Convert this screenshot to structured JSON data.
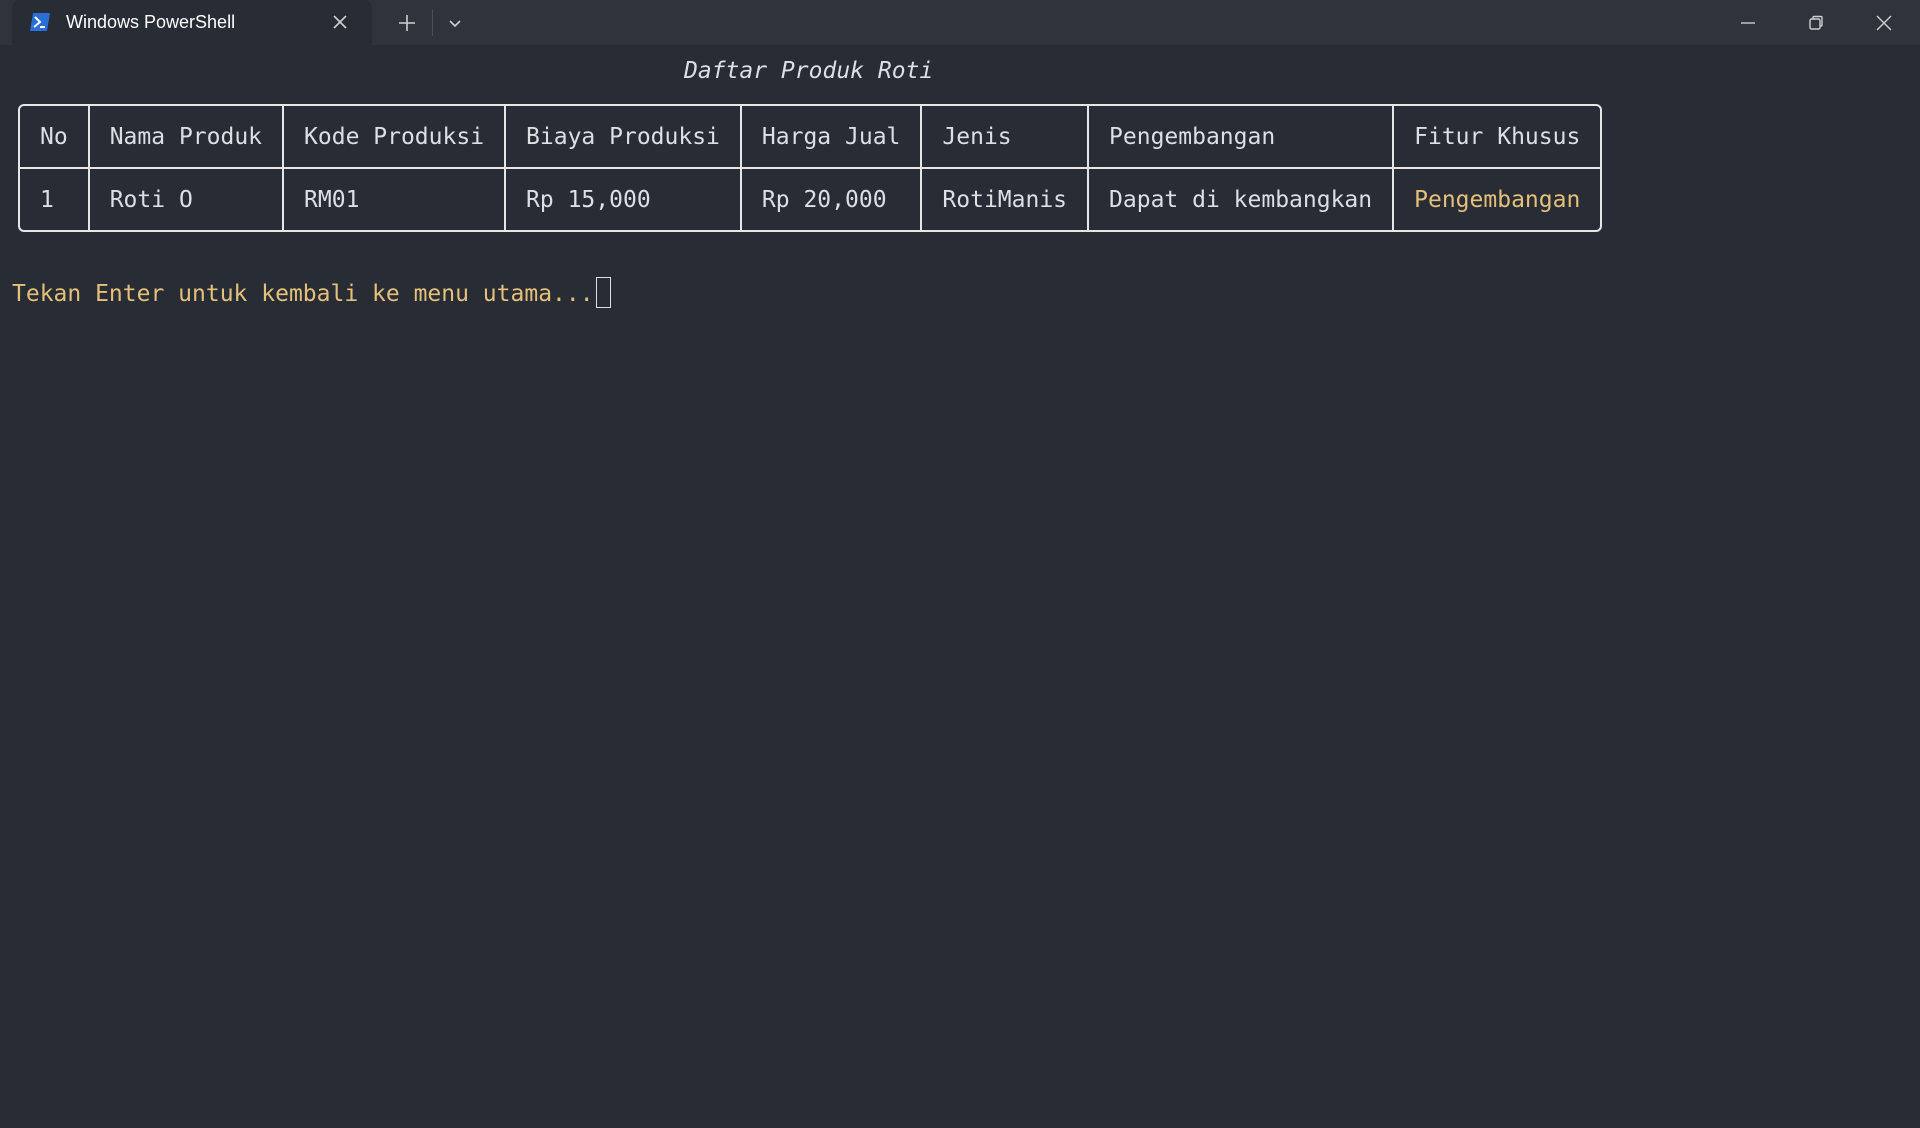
{
  "window": {
    "tab_title": "Windows PowerShell",
    "tab_icon": "powershell-icon",
    "icons": {
      "close_tab": "close-icon",
      "new_tab": "plus-icon",
      "dropdown": "chevron-down-icon",
      "minimize": "minimize-icon",
      "maximize": "restore-icon",
      "close_window": "close-icon"
    }
  },
  "terminal": {
    "title": "Daftar Produk Roti",
    "table": {
      "headers": [
        "No",
        "Nama Produk",
        "Kode Produksi",
        "Biaya Produksi",
        "Harga Jual",
        "Jenis",
        "Pengembangan",
        "Fitur Khusus"
      ],
      "rows": [
        [
          "1",
          "Roti O",
          "RM01",
          "Rp 15,000",
          "Rp 20,000",
          "RotiManis",
          "Dapat di kembangkan",
          "Pengembangan"
        ]
      ]
    },
    "prompt": "Tekan Enter untuk kembali ke menu utama..."
  },
  "colors": {
    "background": "#282c34",
    "titlebar": "#2f333b",
    "text": "#dcdfe4",
    "highlight": "#e5c07b",
    "border": "#e6e6e6"
  }
}
